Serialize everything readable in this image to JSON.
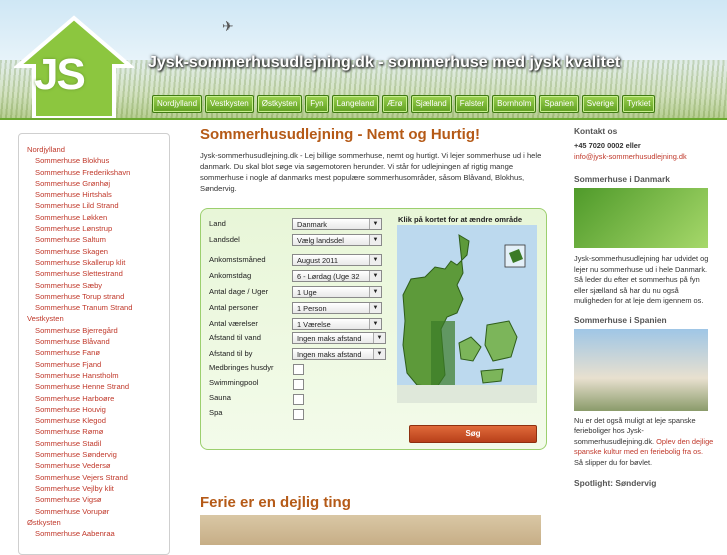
{
  "header": {
    "logo_text": "JS",
    "site_title": "Jysk-sommerhusudlejning.dk - sommerhuse med jysk kvalitet",
    "nav": [
      "Nordjylland",
      "Vestkysten",
      "Østkysten",
      "Fyn",
      "Langeland",
      "Ærø",
      "Sjælland",
      "Falster",
      "Bornholm",
      "Spanien",
      "Sverige",
      "Tyrkiet"
    ]
  },
  "sidebar": {
    "items": [
      {
        "label": "Nordjylland",
        "level": 0
      },
      {
        "label": "Sommerhuse Blokhus",
        "level": 1
      },
      {
        "label": "Sommerhuse Frederikshavn",
        "level": 1
      },
      {
        "label": "Sommerhuse Grønhøj",
        "level": 1
      },
      {
        "label": "Sommerhuse Hirtshals",
        "level": 1
      },
      {
        "label": "Sommerhuse Lild Strand",
        "level": 1
      },
      {
        "label": "Sommerhuse Løkken",
        "level": 1
      },
      {
        "label": "Sommerhuse Lønstrup",
        "level": 1
      },
      {
        "label": "Sommerhuse Saltum",
        "level": 1
      },
      {
        "label": "Sommerhuse Skagen",
        "level": 1
      },
      {
        "label": "Sommerhuse Skallerup klit",
        "level": 1
      },
      {
        "label": "Sommerhuse Slettestrand",
        "level": 1
      },
      {
        "label": "Sommerhuse Sæby",
        "level": 1
      },
      {
        "label": "Sommerhuse Torup strand",
        "level": 1
      },
      {
        "label": "Sommerhuse Tranum Strand",
        "level": 1
      },
      {
        "label": "Vestkysten",
        "level": 0
      },
      {
        "label": "Sommerhuse Bjerregård",
        "level": 1
      },
      {
        "label": "Sommerhuse Blåvand",
        "level": 1
      },
      {
        "label": "Sommerhuse Fanø",
        "level": 1
      },
      {
        "label": "Sommerhuse Fjand",
        "level": 1
      },
      {
        "label": "Sommerhuse Hanstholm",
        "level": 1
      },
      {
        "label": "Sommerhuse Henne Strand",
        "level": 1
      },
      {
        "label": "Sommerhuse Harboøre",
        "level": 1
      },
      {
        "label": "Sommerhuse Houvig",
        "level": 1
      },
      {
        "label": "Sommerhuse Klegod",
        "level": 1
      },
      {
        "label": "Sommerhuse Rømø",
        "level": 1
      },
      {
        "label": "Sommerhuse Stadil",
        "level": 1
      },
      {
        "label": "Sommerhuse Søndervig",
        "level": 1
      },
      {
        "label": "Sommerhuse Vedersø",
        "level": 1
      },
      {
        "label": "Sommerhuse Vejers Strand",
        "level": 1
      },
      {
        "label": "Sommerhuse Vejlby klit",
        "level": 1
      },
      {
        "label": "Sommerhuse Vigsø",
        "level": 1
      },
      {
        "label": "Sommerhuse Vorupør",
        "level": 1
      },
      {
        "label": "Østkysten",
        "level": 0
      },
      {
        "label": "Sommerhuse Aabenraa",
        "level": 1
      }
    ]
  },
  "main": {
    "title": "Sommerhusudlejning - Nemt og Hurtig!",
    "intro": "Jysk-sommerhusudlejning.dk - Lej billige sommerhuse, nemt og hurtigt. Vi lejer sommerhuse ud i hele danmark. Du skal blot søge via søgemotoren herunder. Vi står for udlejningen af rigtig mange sommerhuse i nogle af danmarks mest populære sommerhusområder, såsom Blåvand, Blokhus, Søndervig.",
    "search": {
      "fields": [
        {
          "label": "Land",
          "value": "Danmark"
        },
        {
          "label": "Landsdel",
          "value": "Vælg landsdel"
        },
        {
          "label": "Ankomstsmåned",
          "value": "August 2011"
        },
        {
          "label": "Ankomstdag",
          "value": "6 - Lørdag (Uge 32"
        },
        {
          "label": "Antal dage / Uger",
          "value": "1 Uge"
        },
        {
          "label": "Antal personer",
          "value": "1 Person"
        },
        {
          "label": "Antal værelser",
          "value": "1 Værelse"
        },
        {
          "label": "Afstand til vand",
          "value": "Ingen maks afstand"
        },
        {
          "label": "Afstand til by",
          "value": "Ingen maks afstand"
        }
      ],
      "checks": [
        "Medbringes husdyr",
        "Swimmingpool",
        "Sauna",
        "Spa"
      ],
      "map_label": "Klik på kortet for at ændre område",
      "button": "Søg"
    },
    "subtitle": "Ferie er en dejlig ting"
  },
  "right": {
    "contact_title": "Kontakt os",
    "phone": "+45 7020 0002 eller",
    "email": "info@jysk-sommerhusudlejning.dk",
    "dk_title": "Sommerhuse i Danmark",
    "dk_text": "Jysk-sommerhusudlejning har udvidet og lejer nu sommerhuse ud i hele Danmark. Så leder du efter et sommerhus på fyn eller sjælland så har du nu også muligheden for at leje dem igennem os.",
    "es_title": "Sommerhuse i Spanien",
    "es_text": "Nu er det også muligt at leje spanske ferieboliger hos Jysk-sommerhusudlejning.dk.",
    "es_link": "Oplev den dejlige spanske kultur med en feriebolig fra os.",
    "es_end": "Så slipper du for bøvlet.",
    "spot_title": "Spotlight: Søndervig"
  },
  "colors": {
    "accent": "#b55a17",
    "green": "#6aa82f",
    "link": "#c0392b"
  }
}
